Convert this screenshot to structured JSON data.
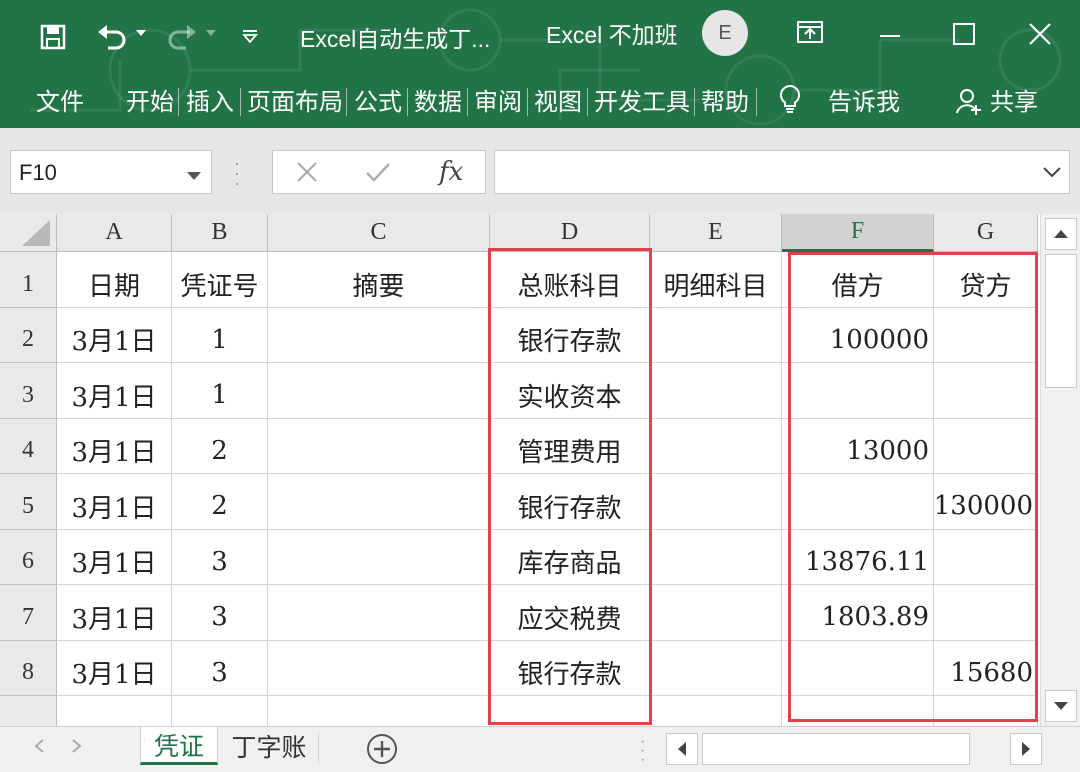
{
  "window": {
    "title": "Excel自动生成丁...",
    "account_title": "Excel 不加班",
    "avatar_initial": "E"
  },
  "ribbon": {
    "tabs": [
      "文件",
      "开始",
      "插入",
      "页面布局",
      "公式",
      "数据",
      "审阅",
      "视图",
      "开发工具",
      "帮助"
    ],
    "tell_me": "告诉我",
    "share": "共享"
  },
  "formula_bar": {
    "name_box": "F10",
    "fx_label": "fx",
    "content": ""
  },
  "sheet": {
    "columns": [
      "A",
      "B",
      "C",
      "D",
      "E",
      "F",
      "G"
    ],
    "selected_column": "F",
    "row_numbers": [
      "1",
      "2",
      "3",
      "4",
      "5",
      "6",
      "7",
      "8"
    ],
    "rows": [
      [
        "日期",
        "凭证号",
        "摘要",
        "总账科目",
        "明细科目",
        "借方",
        "贷方"
      ],
      [
        "3月1日",
        "1",
        "",
        "银行存款",
        "",
        "100000",
        ""
      ],
      [
        "3月1日",
        "1",
        "",
        "实收资本",
        "",
        "",
        ""
      ],
      [
        "3月1日",
        "2",
        "",
        "管理费用",
        "",
        "13000",
        ""
      ],
      [
        "3月1日",
        "2",
        "",
        "银行存款",
        "",
        "",
        "130000"
      ],
      [
        "3月1日",
        "3",
        "",
        "库存商品",
        "",
        "13876.11",
        ""
      ],
      [
        "3月1日",
        "3",
        "",
        "应交税费",
        "",
        "1803.89",
        ""
      ],
      [
        "3月1日",
        "3",
        "",
        "银行存款",
        "",
        "",
        "15680"
      ]
    ],
    "highlight_color": "#e0424a"
  },
  "sheet_tabs": {
    "active": "凭证",
    "inactive": "丁字账"
  },
  "colors": {
    "ribbon_green": "#227447",
    "accent_green": "#217346"
  }
}
